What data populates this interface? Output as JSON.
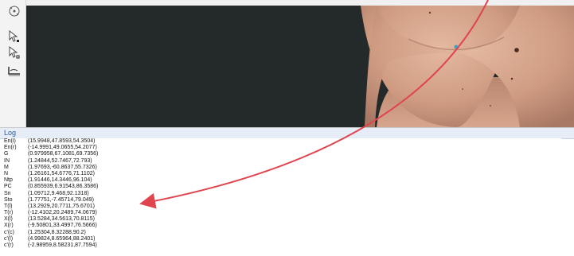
{
  "log": {
    "title": "Log",
    "entries": [
      {
        "key": "En(l)",
        "value": "(15.9948,47.8593,54.3504)"
      },
      {
        "key": "En(r)",
        "value": "(-14.9991,49.0655,54.2077)"
      },
      {
        "key": "G",
        "value": "(0.979958,67.1081,69.7356)"
      },
      {
        "key": "IN",
        "value": "(1.24844,52.7467,72.793)"
      },
      {
        "key": "M",
        "value": "(1.97693,-60.8637,55.7326)"
      },
      {
        "key": "N",
        "value": "(1.26161,54.6776,71.1102)"
      },
      {
        "key": "Ntp",
        "value": "(1.91446,14.3446,96.104)"
      },
      {
        "key": "PC",
        "value": "(0.855939,6.91543,86.3586)"
      },
      {
        "key": "Sn",
        "value": "(1.09712,9.468,92.1318)"
      },
      {
        "key": "Sto",
        "value": "(1.77751,-7.45714,79.049)"
      },
      {
        "key": "T(l)",
        "value": "(13.2929,20.7711,75.6701)"
      },
      {
        "key": "T(r)",
        "value": "(-12.4102,20.2489,74.0679)"
      },
      {
        "key": "X(l)",
        "value": "(13.5284,34.5613,70.8115)"
      },
      {
        "key": "X(r)",
        "value": "(-9.50801,33.4997,76.5666)"
      },
      {
        "key": "c'(c)",
        "value": "(1.25304,8.32288,90.2)"
      },
      {
        "key": "c'(l)",
        "value": "(4.99824,8.65964,88.2401)"
      },
      {
        "key": "c'(r)",
        "value": "(-2.98959,8.58231,87.7594)"
      }
    ]
  },
  "tools": [
    {
      "icon": "rotate-tool-icon"
    },
    {
      "icon": "select-tool-icon"
    },
    {
      "icon": "select-deselect-tool-icon"
    },
    {
      "icon": "landmark-tool-icon"
    }
  ],
  "colors": {
    "viewport_bg": "#242a29",
    "annotation_arrow": "#e0454f",
    "landmark_marker": "#3aa3c9"
  }
}
